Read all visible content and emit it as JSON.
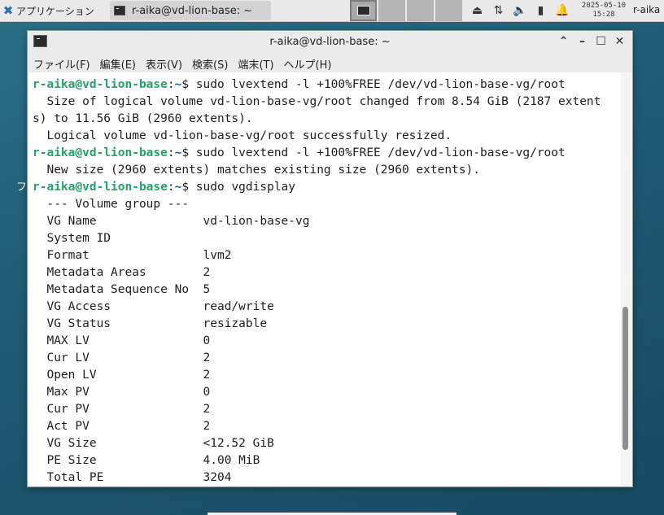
{
  "panel": {
    "apps_label": "アプリケーション",
    "task_label": "r-aika@vd-lion-base: ~",
    "clock_date": "2025-05-10",
    "clock_time": "15:28",
    "user": "r-aika",
    "tray_icons": [
      "removable-drive-icon",
      "network-icon",
      "volume-icon",
      "battery-icon",
      "notification-bell-icon"
    ]
  },
  "desktop": {
    "icon_label": "フ"
  },
  "window": {
    "title": "r-aika@vd-lion-base: ~",
    "menu": [
      "ファイル(F)",
      "編集(E)",
      "表示(V)",
      "検索(S)",
      "端末(T)",
      "ヘルプ(H)"
    ]
  },
  "terminal": {
    "prompt_user": "r-aika@vd-lion-base",
    "prompt_path": "~",
    "lines": [
      {
        "type": "cmd",
        "text": "$ sudo lvextend -l +100%FREE /dev/vd-lion-base-vg/root"
      },
      {
        "type": "out",
        "text": "  Size of logical volume vd-lion-base-vg/root changed from 8.54 GiB (2187 extent"
      },
      {
        "type": "out",
        "text": "s) to 11.56 GiB (2960 extents)."
      },
      {
        "type": "out",
        "text": "  Logical volume vd-lion-base-vg/root successfully resized."
      },
      {
        "type": "cmd",
        "text": "$ sudo lvextend -l +100%FREE /dev/vd-lion-base-vg/root"
      },
      {
        "type": "out",
        "text": "  New size (2960 extents) matches existing size (2960 extents)."
      },
      {
        "type": "cmd",
        "text": "$ sudo vgdisplay"
      },
      {
        "type": "out",
        "text": "  --- Volume group ---"
      },
      {
        "type": "out",
        "text": "  VG Name               vd-lion-base-vg"
      },
      {
        "type": "out",
        "text": "  System ID"
      },
      {
        "type": "out",
        "text": "  Format                lvm2"
      },
      {
        "type": "out",
        "text": "  Metadata Areas        2"
      },
      {
        "type": "out",
        "text": "  Metadata Sequence No  5"
      },
      {
        "type": "out",
        "text": "  VG Access             read/write"
      },
      {
        "type": "out",
        "text": "  VG Status             resizable"
      },
      {
        "type": "out",
        "text": "  MAX LV                0"
      },
      {
        "type": "out",
        "text": "  Cur LV                2"
      },
      {
        "type": "out",
        "text": "  Open LV               2"
      },
      {
        "type": "out",
        "text": "  Max PV                0"
      },
      {
        "type": "out",
        "text": "  Cur PV                2"
      },
      {
        "type": "out",
        "text": "  Act PV                2"
      },
      {
        "type": "out",
        "text": "  VG Size               <12.52 GiB"
      },
      {
        "type": "out",
        "text": "  PE Size               4.00 MiB"
      },
      {
        "type": "out",
        "text": "  Total PE              3204"
      }
    ]
  }
}
